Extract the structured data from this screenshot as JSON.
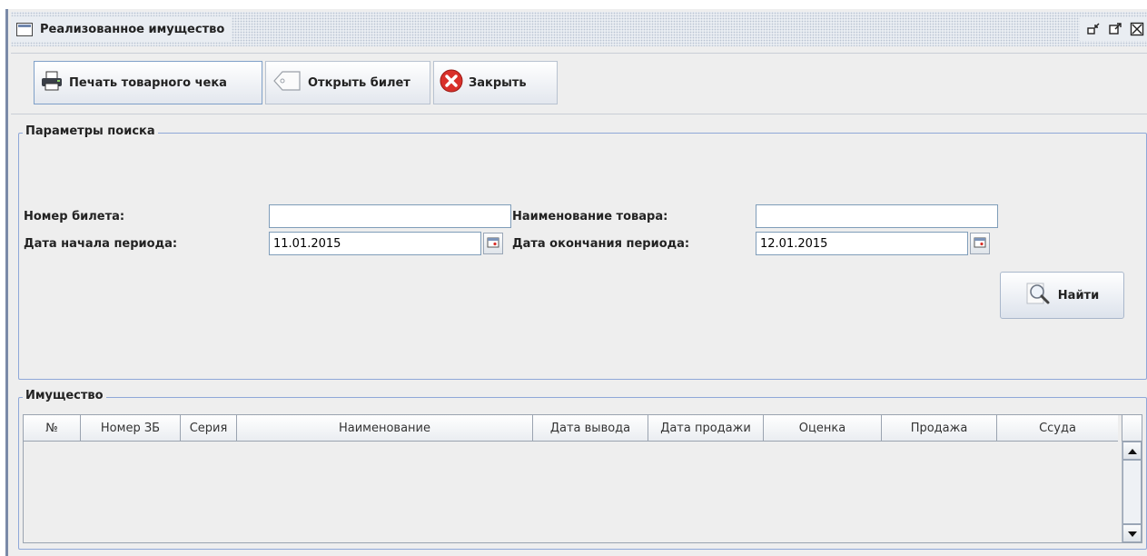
{
  "window": {
    "title": "Реализованное имущество",
    "controls": [
      "minimize-icon",
      "maximize-icon",
      "close-icon"
    ]
  },
  "toolbar": {
    "print_receipt_label": "Печать товарного чека",
    "open_ticket_label": "Открыть билет",
    "close_label": "Закрыть"
  },
  "search": {
    "group_title": "Параметры поиска",
    "ticket_number_label": "Номер билета:",
    "ticket_number_value": "",
    "item_name_label": "Наименование товара:",
    "item_name_value": "",
    "start_date_label": "Дата начала периода:",
    "start_date_value": "11.01.2015",
    "end_date_label": "Дата окончания периода:",
    "end_date_value": "12.01.2015",
    "find_label": "Найти"
  },
  "property": {
    "group_title": "Имущество",
    "columns": [
      "№",
      "Номер ЗБ",
      "Серия",
      "Наименование",
      "Дата вывода",
      "Дата продажи",
      "Оценка",
      "Продажа",
      "Ссуда"
    ],
    "rows": []
  },
  "colors": {
    "window_bg": "#eeeeee",
    "group_border": "#8fa8d8",
    "close_icon_red": "#d9302a"
  }
}
